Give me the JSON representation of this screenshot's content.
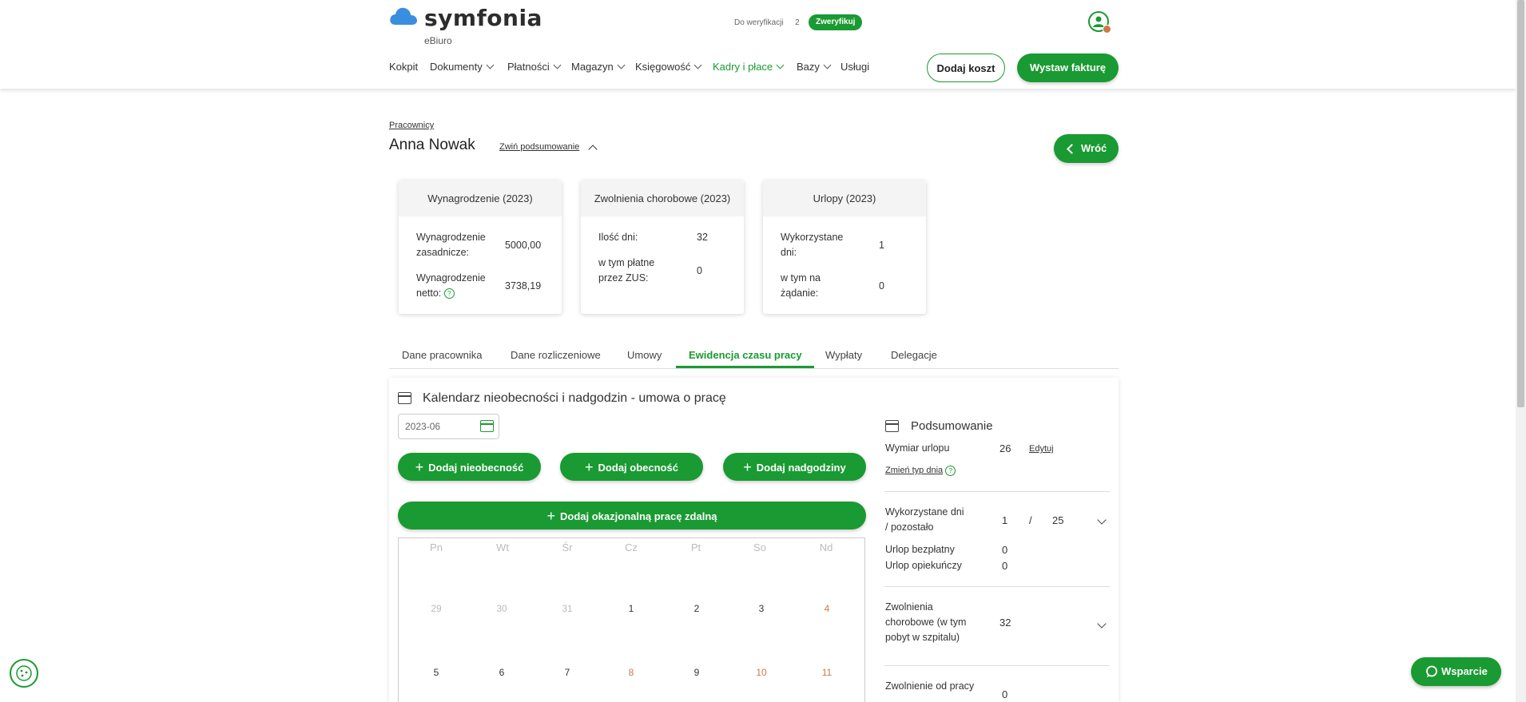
{
  "header": {
    "logo_text": "symfonia",
    "logo_sub": "eBiuro",
    "verify_label": "Do weryfikacji",
    "verify_count": "2",
    "verify_button": "Zweryfikuj",
    "nav": [
      {
        "label": "Kokpit"
      },
      {
        "label": "Dokumenty"
      },
      {
        "label": "Płatności"
      },
      {
        "label": "Magazyn"
      },
      {
        "label": "Księgowość"
      },
      {
        "label": "Kadry i płace"
      },
      {
        "label": "Bazy"
      },
      {
        "label": "Usługi"
      }
    ],
    "add_cost": "Dodaj koszt",
    "issue_invoice": "Wystaw fakturę"
  },
  "page": {
    "breadcrumb": "Pracownicy",
    "title": "Anna Nowak",
    "collapse": "Zwiń podsumowanie",
    "back": "Wróć"
  },
  "cards": {
    "salary": {
      "title": "Wynagrodzenie (2023)",
      "base_label": "Wynagrodzenie zasadnicze:",
      "base_value": "5000,00",
      "net_label": "Wynagrodzenie netto:",
      "net_value": "3738,19"
    },
    "sick": {
      "title": "Zwolnienia chorobowe (2023)",
      "days_label": "Ilość dni:",
      "days_value": "32",
      "zus_label": "w tym płatne przez ZUS:",
      "zus_value": "0"
    },
    "leave": {
      "title": "Urlopy (2023)",
      "used_label": "Wykorzystane dni:",
      "used_value": "1",
      "demand_label": "w tym na żądanie:",
      "demand_value": "0"
    }
  },
  "tabs": [
    {
      "label": "Dane pracownika"
    },
    {
      "label": "Dane rozliczeniowe"
    },
    {
      "label": "Umowy"
    },
    {
      "label": "Ewidencja czasu pracy"
    },
    {
      "label": "Wypłaty"
    },
    {
      "label": "Delegacje"
    }
  ],
  "calendar": {
    "title": "Kalendarz nieobecności i nadgodzin - umowa o pracę",
    "month": "2023-06",
    "add_absence": "Dodaj nieobecność",
    "add_presence": "Dodaj obecność",
    "add_overtime": "Dodaj nadgodziny",
    "add_remote": "Dodaj okazjonalną pracę zdalną",
    "weekdays": [
      "Pn",
      "Wt",
      "Śr",
      "Cz",
      "Pt",
      "So",
      "Nd"
    ],
    "week1": [
      "29",
      "30",
      "31",
      "1",
      "2",
      "3",
      "4"
    ],
    "week2": [
      "5",
      "6",
      "7",
      "8",
      "9",
      "10",
      "11"
    ]
  },
  "summary": {
    "title": "Podsumowanie",
    "leave_dim_label": "Wymiar urlopu",
    "leave_dim_value": "26",
    "edit": "Edytuj",
    "change_day_type": "Zmień typ dnia",
    "used_label": "Wykorzystane dni / pozostało",
    "used_value": "1",
    "slash": "/",
    "remaining_value": "25",
    "unpaid_label": "Urlop bezpłatny",
    "unpaid_value": "0",
    "care_label": "Urlop opiekuńczy",
    "care_value": "0",
    "sick_label": "Zwolnienia chorobowe (w tym pobyt w szpitalu)",
    "sick_value": "32",
    "release_label": "Zwolnienie od pracy",
    "release_value": "0"
  },
  "support": "Wsparcie",
  "colors": {
    "accent": "#1a9a32",
    "weekend": "#c97a46"
  }
}
